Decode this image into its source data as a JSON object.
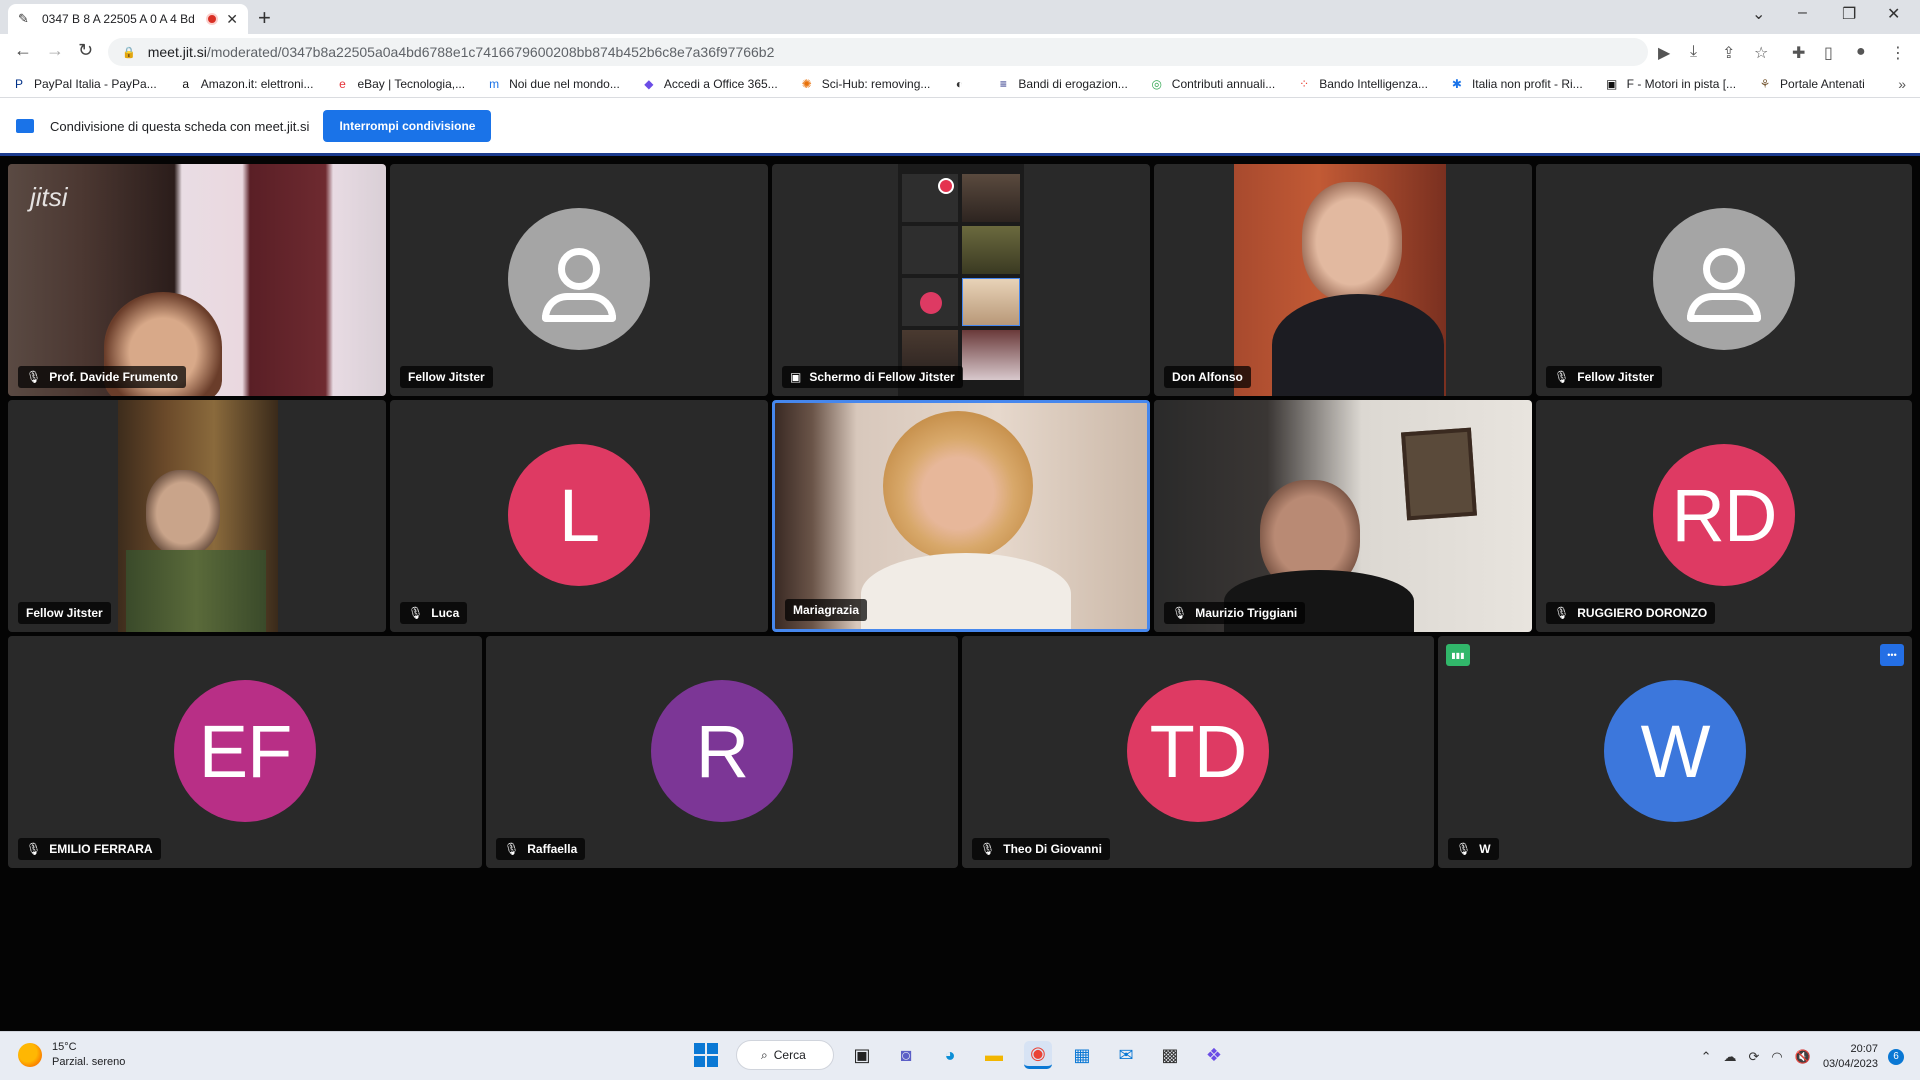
{
  "browser": {
    "tab_title": "0347 B 8 A 22505 A 0 A 4 Bd",
    "tab_close": "✕",
    "new_tab": "+",
    "url_host": "meet.jit.si",
    "url_path": "/moderated/0347b8a22505a0a4bd6788e1c7416679600208bb874b452b6c8e7a36f97766b2",
    "bookmarks": [
      {
        "label": "PayPal Italia - PayPa...",
        "icon": "P",
        "color": "#003087"
      },
      {
        "label": "Amazon.it: elettroni...",
        "icon": "a",
        "color": "#111111"
      },
      {
        "label": "eBay | Tecnologia,...",
        "icon": "e",
        "color": "#e53238"
      },
      {
        "label": "Noi due nel mondo...",
        "icon": "m",
        "color": "#1a73e8"
      },
      {
        "label": "Accedi a Office 365...",
        "icon": "◆",
        "color": "#6b4de6"
      },
      {
        "label": "Sci-Hub: removing...",
        "icon": "✺",
        "color": "#e8710a"
      },
      {
        "label": "",
        "icon": "◐",
        "color": "#333333"
      },
      {
        "label": "Bandi di erogazion...",
        "icon": "≡",
        "color": "#1a237e"
      },
      {
        "label": "Contributi annuali...",
        "icon": "◎",
        "color": "#34a853"
      },
      {
        "label": "Bando Intelligenza...",
        "icon": "⁘",
        "color": "#ea4335"
      },
      {
        "label": "Italia non profit - Ri...",
        "icon": "✱",
        "color": "#1a73e8"
      },
      {
        "label": "F - Motori in pista [...",
        "icon": "▣",
        "color": "#111111"
      },
      {
        "label": "Portale Antenati",
        "icon": "⚘",
        "color": "#7b5e3a"
      }
    ],
    "bookmarks_more": "»"
  },
  "share_bar": {
    "text": "Condivisione di questa scheda con meet.jit.si",
    "stop_button": "Interrompi condivisione"
  },
  "meeting": {
    "watermark": "jitsi",
    "mic_icon": "🎙",
    "tiles": [
      {
        "name": "Prof. Davide Frumento",
        "muted": true
      },
      {
        "name": "Fellow Jitster",
        "muted": false
      },
      {
        "name": "Schermo di Fellow Jitster",
        "muted": false
      },
      {
        "name": "Don Alfonso",
        "muted": false
      },
      {
        "name": "Fellow Jitster",
        "muted": true
      },
      {
        "name": "Fellow Jitster",
        "muted": false
      },
      {
        "name": "Luca",
        "muted": true,
        "initials": "L",
        "color": "#de3a63"
      },
      {
        "name": "Mariagrazia",
        "muted": false
      },
      {
        "name": "Maurizio Triggiani",
        "muted": true
      },
      {
        "name": "RUGGIERO DORONZO",
        "muted": true,
        "initials": "RD",
        "color": "#de3a63"
      },
      {
        "name": "EMILIO FERRARA",
        "muted": true,
        "initials": "EF",
        "color": "#b82f86"
      },
      {
        "name": "Raffaella",
        "muted": true,
        "initials": "R",
        "color": "#7c3696"
      },
      {
        "name": "Theo Di Giovanni",
        "muted": true,
        "initials": "TD",
        "color": "#de3a63"
      },
      {
        "name": "W",
        "muted": true,
        "initials": "W",
        "color": "#3c77dc"
      }
    ],
    "indicator_signal": "▮▮▮",
    "indicator_more": "•••"
  },
  "taskbar": {
    "weather_temp": "15°C",
    "weather_desc": "Parzial. sereno",
    "search_label": "Cerca",
    "time": "20:07",
    "date": "03/04/2023",
    "notifications": "6"
  }
}
